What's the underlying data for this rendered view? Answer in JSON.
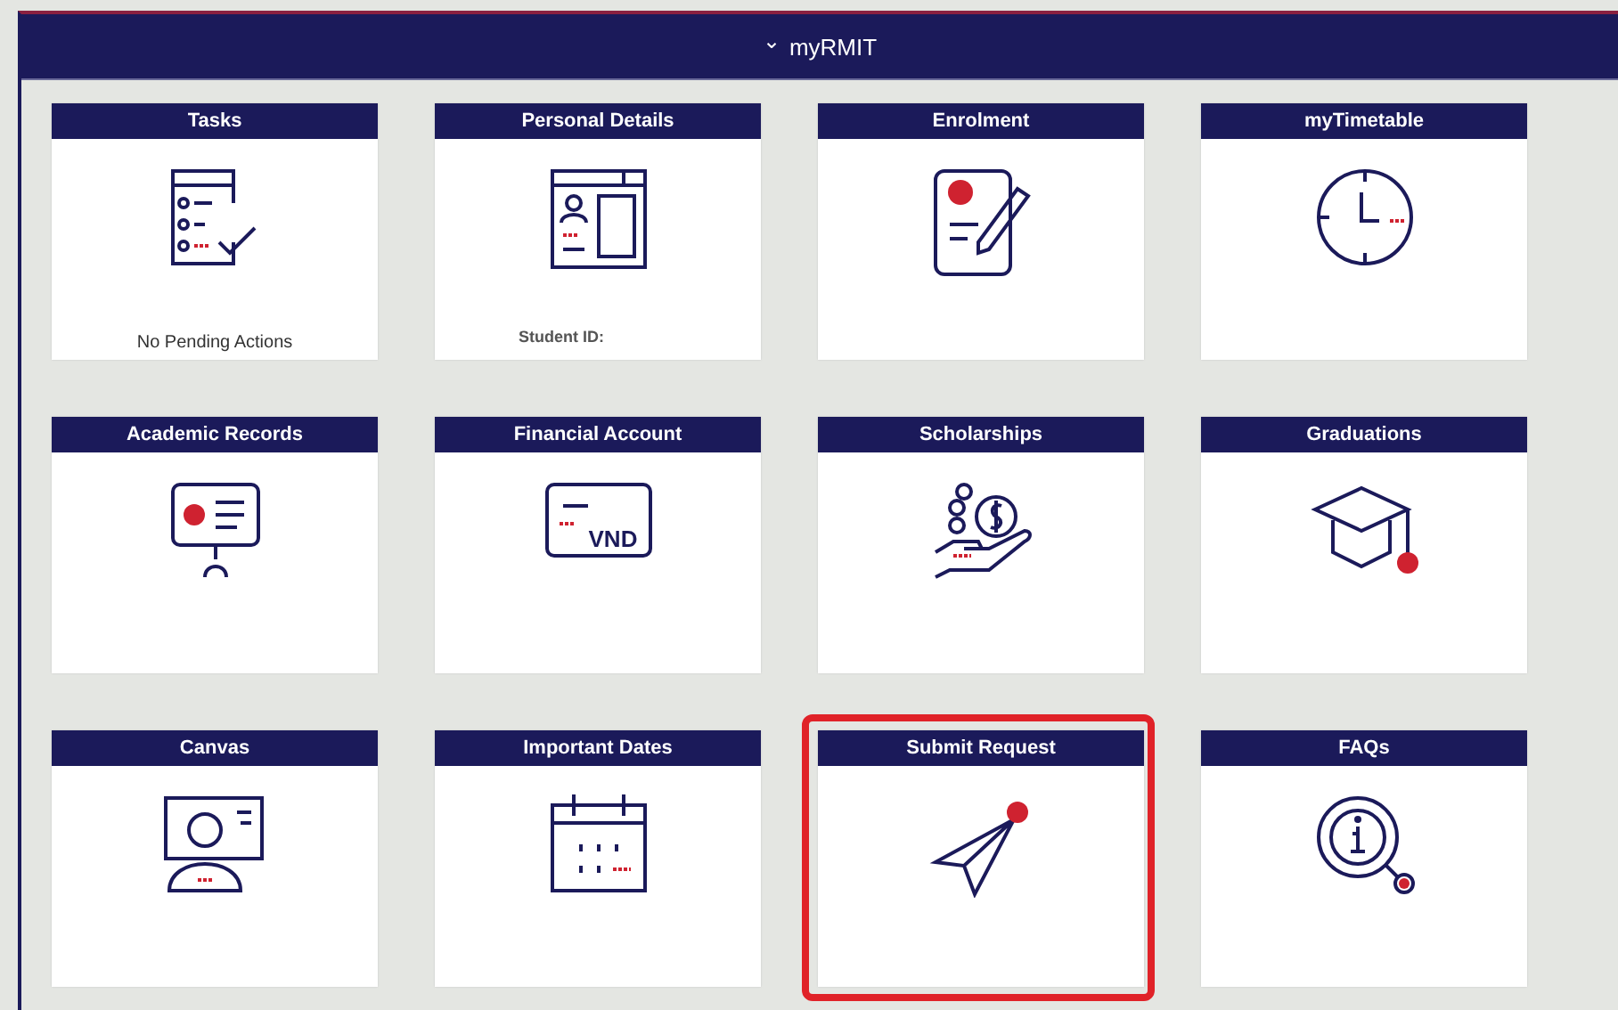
{
  "header": {
    "caret": "⌄",
    "title": "myRMIT"
  },
  "tiles": [
    {
      "title": "Tasks",
      "kind": "tasks",
      "footer": "No Pending Actions",
      "highlighted": false
    },
    {
      "title": "Personal Details",
      "kind": "profile",
      "footer": "Student ID:",
      "highlighted": false
    },
    {
      "title": "Enrolment",
      "kind": "enrolment",
      "highlighted": false
    },
    {
      "title": "myTimetable",
      "kind": "clock",
      "highlighted": false
    },
    {
      "title": "Academic Records",
      "kind": "records",
      "highlighted": false
    },
    {
      "title": "Financial Account",
      "kind": "card",
      "icon_text": "VND",
      "highlighted": false
    },
    {
      "title": "Scholarships",
      "kind": "coins",
      "highlighted": false
    },
    {
      "title": "Graduations",
      "kind": "cap",
      "highlighted": false
    },
    {
      "title": "Canvas",
      "kind": "canvas",
      "highlighted": false
    },
    {
      "title": "Important Dates",
      "kind": "calendar",
      "highlighted": false
    },
    {
      "title": "Submit Request",
      "kind": "send",
      "highlighted": true
    },
    {
      "title": "FAQs",
      "kind": "info",
      "highlighted": false
    }
  ]
}
